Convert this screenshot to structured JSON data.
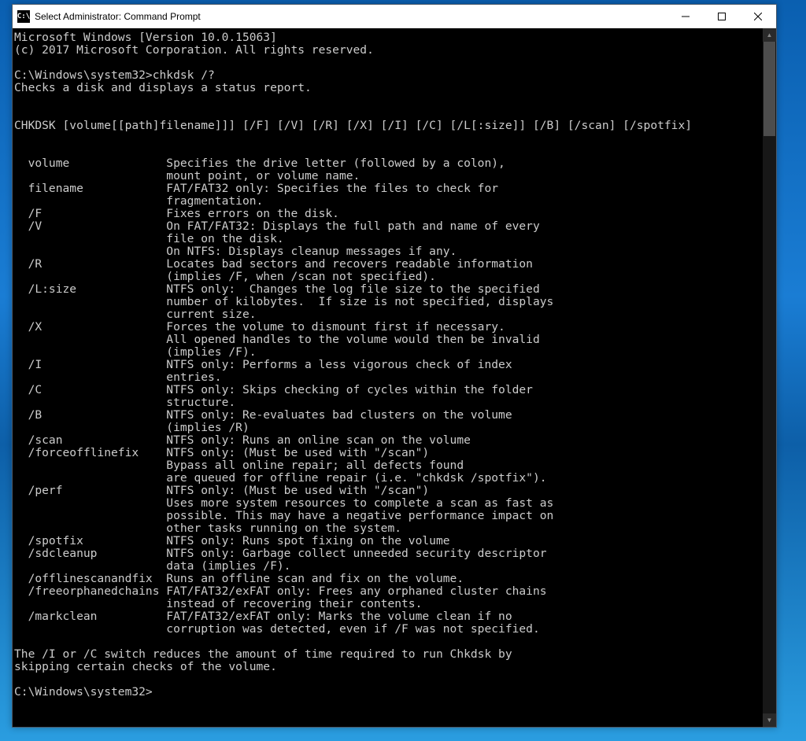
{
  "window": {
    "title": "Select Administrator: Command Prompt",
    "icon_label": "C:\\"
  },
  "header": {
    "line1": "Microsoft Windows [Version 10.0.15063]",
    "line2": "(c) 2017 Microsoft Corporation. All rights reserved."
  },
  "prompt1": "C:\\Windows\\system32>chkdsk /?",
  "description": "Checks a disk and displays a status report.",
  "syntax": "CHKDSK [volume[[path]filename]]] [/F] [/V] [/R] [/X] [/I] [/C] [/L[:size]] [/B] [/scan] [/spotfix]",
  "params": [
    {
      "name": "  volume",
      "desc": "Specifies the drive letter (followed by a colon),"
    },
    {
      "name": "",
      "desc": "mount point, or volume name."
    },
    {
      "name": "  filename",
      "desc": "FAT/FAT32 only: Specifies the files to check for"
    },
    {
      "name": "",
      "desc": "fragmentation."
    },
    {
      "name": "  /F",
      "desc": "Fixes errors on the disk."
    },
    {
      "name": "  /V",
      "desc": "On FAT/FAT32: Displays the full path and name of every"
    },
    {
      "name": "",
      "desc": "file on the disk."
    },
    {
      "name": "",
      "desc": "On NTFS: Displays cleanup messages if any."
    },
    {
      "name": "  /R",
      "desc": "Locates bad sectors and recovers readable information"
    },
    {
      "name": "",
      "desc": "(implies /F, when /scan not specified)."
    },
    {
      "name": "  /L:size",
      "desc": "NTFS only:  Changes the log file size to the specified"
    },
    {
      "name": "",
      "desc": "number of kilobytes.  If size is not specified, displays"
    },
    {
      "name": "",
      "desc": "current size."
    },
    {
      "name": "  /X",
      "desc": "Forces the volume to dismount first if necessary."
    },
    {
      "name": "",
      "desc": "All opened handles to the volume would then be invalid"
    },
    {
      "name": "",
      "desc": "(implies /F)."
    },
    {
      "name": "  /I",
      "desc": "NTFS only: Performs a less vigorous check of index"
    },
    {
      "name": "",
      "desc": "entries."
    },
    {
      "name": "  /C",
      "desc": "NTFS only: Skips checking of cycles within the folder"
    },
    {
      "name": "",
      "desc": "structure."
    },
    {
      "name": "  /B",
      "desc": "NTFS only: Re-evaluates bad clusters on the volume"
    },
    {
      "name": "",
      "desc": "(implies /R)"
    },
    {
      "name": "  /scan",
      "desc": "NTFS only: Runs an online scan on the volume"
    },
    {
      "name": "  /forceofflinefix",
      "desc": "NTFS only: (Must be used with \"/scan\")"
    },
    {
      "name": "",
      "desc": "Bypass all online repair; all defects found"
    },
    {
      "name": "",
      "desc": "are queued for offline repair (i.e. \"chkdsk /spotfix\")."
    },
    {
      "name": "  /perf",
      "desc": "NTFS only: (Must be used with \"/scan\")"
    },
    {
      "name": "",
      "desc": "Uses more system resources to complete a scan as fast as"
    },
    {
      "name": "",
      "desc": "possible. This may have a negative performance impact on"
    },
    {
      "name": "",
      "desc": "other tasks running on the system."
    },
    {
      "name": "  /spotfix",
      "desc": "NTFS only: Runs spot fixing on the volume"
    },
    {
      "name": "  /sdcleanup",
      "desc": "NTFS only: Garbage collect unneeded security descriptor"
    },
    {
      "name": "",
      "desc": "data (implies /F)."
    },
    {
      "name": "  /offlinescanandfix",
      "desc": "Runs an offline scan and fix on the volume."
    },
    {
      "name": "  /freeorphanedchains",
      "desc": "FAT/FAT32/exFAT only: Frees any orphaned cluster chains"
    },
    {
      "name": "",
      "desc": "instead of recovering their contents."
    },
    {
      "name": "  /markclean",
      "desc": "FAT/FAT32/exFAT only: Marks the volume clean if no"
    },
    {
      "name": "",
      "desc": "corruption was detected, even if /F was not specified."
    }
  ],
  "footer": {
    "line1": "The /I or /C switch reduces the amount of time required to run Chkdsk by",
    "line2": "skipping certain checks of the volume."
  },
  "prompt2": "C:\\Windows\\system32>"
}
